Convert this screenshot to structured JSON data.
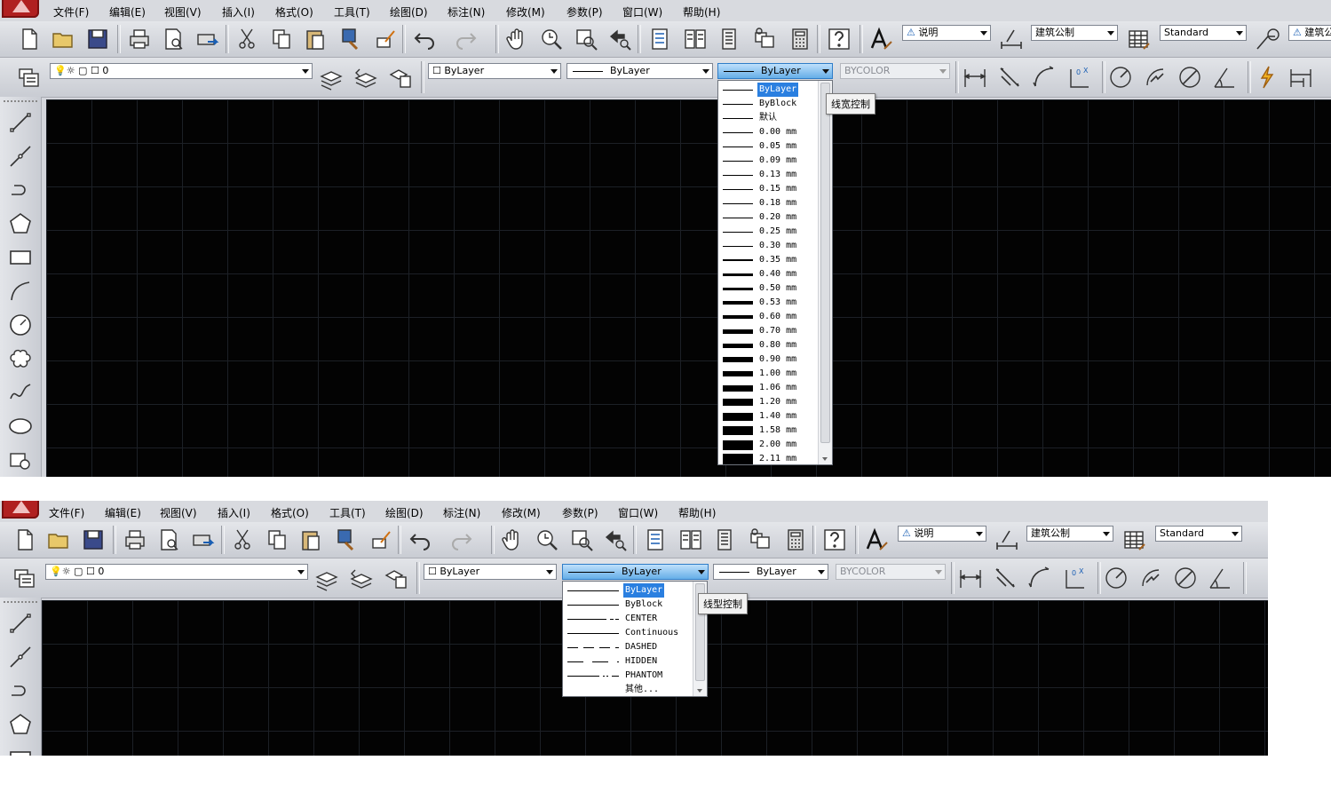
{
  "menu": [
    "文件(F)",
    "编辑(E)",
    "视图(V)",
    "插入(I)",
    "格式(O)",
    "工具(T)",
    "绘图(D)",
    "标注(N)",
    "修改(M)",
    "参数(P)",
    "窗口(W)",
    "帮助(H)"
  ],
  "toolbar": {
    "text_style": "说明",
    "dim_style": "建筑公制",
    "table_style": "Standard",
    "extra_style_partial": "建筑公"
  },
  "properties": {
    "layer_value": "0",
    "color_value": "ByLayer",
    "linetype_value": "ByLayer",
    "lineweight_value": "ByLayer",
    "plotstyle_value": "BYCOLOR"
  },
  "lineweight_dropdown": {
    "tooltip": "线宽控制",
    "items": [
      "ByLayer",
      "ByBlock",
      "默认",
      "0.00 mm",
      "0.05 mm",
      "0.09 mm",
      "0.13 mm",
      "0.15 mm",
      "0.18 mm",
      "0.20 mm",
      "0.25 mm",
      "0.30 mm",
      "0.35 mm",
      "0.40 mm",
      "0.50 mm",
      "0.53 mm",
      "0.60 mm",
      "0.70 mm",
      "0.80 mm",
      "0.90 mm",
      "1.00 mm",
      "1.06 mm",
      "1.20 mm",
      "1.40 mm",
      "1.58 mm",
      "2.00 mm",
      "2.11 mm"
    ],
    "selected": "ByLayer"
  },
  "linetype_dropdown": {
    "tooltip": "线型控制",
    "items": [
      "ByLayer",
      "ByBlock",
      "CENTER",
      "Continuous",
      "DASHED",
      "HIDDEN",
      "PHANTOM",
      "其他..."
    ],
    "selected": "ByLayer"
  },
  "colors": {
    "canvas": "#030303",
    "grid": "#1c2026",
    "highlight": "#2a7fe0",
    "toolbar": "#d4d6dc"
  }
}
